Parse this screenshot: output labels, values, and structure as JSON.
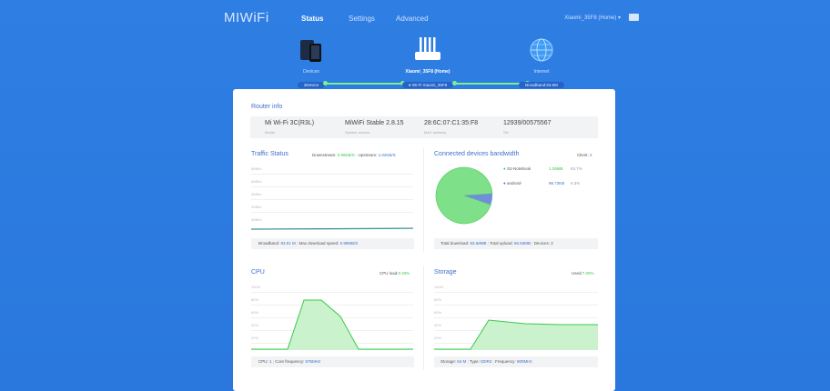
{
  "header": {
    "logo": "MIWiFi",
    "nav": [
      "Status",
      "Settings",
      "Advanced"
    ],
    "user": "Xiaomi_35F8 (Home) ▾"
  },
  "topology": {
    "devices": {
      "label": "Devices",
      "badge": "3Device"
    },
    "router": {
      "label": "Xiaomi_35F8 (Home)",
      "badge": "● Wi-Fi Xiaomi_35F8"
    },
    "internet": {
      "label": "Internet",
      "badge": "Broadband:83.6M"
    }
  },
  "router_info": {
    "title": "Router info",
    "fields": [
      {
        "value": "Mi Wi-Fi 3C(R3L)",
        "label": "Model"
      },
      {
        "value": "MiWiFi Stable 2.8.15",
        "label": "System version"
      },
      {
        "value": "28:6C:07:C1:35:F8",
        "label": "MAC address"
      },
      {
        "value": "12939/00575567",
        "label": "SN"
      }
    ]
  },
  "traffic": {
    "title": "Traffic Status",
    "downstream_label": "Downstream:",
    "downstream_value": "0.99KB/S",
    "upstream_label": "Upstream:",
    "upstream_value": "1.02KB/S",
    "yticks": [
      "8MB/s",
      "6MB/s",
      "4MB/s",
      "2MB/s",
      "0MB/s"
    ],
    "footer_broadband_label": "Broadband:",
    "footer_broadband": "83.01 M",
    "footer_max_label": "Max download speed:",
    "footer_max": "0.98MB/S"
  },
  "bandwidth": {
    "title": "Connected devices bandwidth",
    "client_label": "Client:",
    "client_count": "2",
    "devices": [
      {
        "name": "S2-Notebook",
        "size": "1.39MB",
        "pct": "93.7%",
        "color": "#3cc84d"
      },
      {
        "name": "android-",
        "size": "95.73KB",
        "pct": "6.3%",
        "color": "#3f6fce"
      }
    ],
    "footer_download_label": "Total download:",
    "footer_download": "83.68MB",
    "footer_upload_label": "Total upload:",
    "footer_upload": "66.94MB",
    "footer_devices_label": "Devices:",
    "footer_devices": "2"
  },
  "cpu": {
    "title": "CPU",
    "load_label": "CPU load:",
    "load_value": "0.20%",
    "yticks": [
      "100%",
      "80%",
      "60%",
      "40%",
      "20%"
    ],
    "footer_cpu_label": "CPU:",
    "footer_cpu": "1",
    "footer_freq_label": "Core frequency:",
    "footer_freq": "575MHz"
  },
  "storage": {
    "title": "Storage",
    "used_label": "Used:",
    "used_value": "7.00%",
    "yticks": [
      "100%",
      "80%",
      "60%",
      "40%",
      "20%"
    ],
    "footer_storage_label": "Storage:",
    "footer_storage": "64 M",
    "footer_type_label": "Type:",
    "footer_type": "DDR2",
    "footer_freq_label": "Frequency:",
    "footer_freq": "800MHz"
  },
  "colors": {
    "accent": "#2f7fe4",
    "green": "#3cc84d",
    "link_blue": "#3f6fce"
  }
}
